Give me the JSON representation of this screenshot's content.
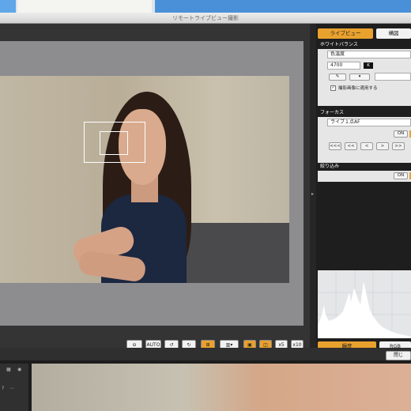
{
  "window": {
    "title": "リモートライブビュー撮影"
  },
  "right_panel": {
    "tabs": [
      "ライブビュー",
      "構図"
    ],
    "white_balance": {
      "header": "ホワイトバランス",
      "mode": "色温度",
      "kelvin_value": "4700",
      "kelvin_unit": "K",
      "apply_checkbox_label": "撮影画像に適用する",
      "apply_checked": true
    },
    "focus": {
      "header": "フォーカス",
      "af_mode": "ライブ１点AF",
      "on_label": "ON",
      "nav_buttons": [
        "<<<",
        "<<",
        "<",
        ">",
        ">>"
      ]
    },
    "aperture": {
      "header": "絞り込み",
      "on_label": "ON"
    },
    "histogram_tabs": [
      "輝度",
      "RGB"
    ]
  },
  "toolbar": {
    "auto_label": "AUTO",
    "zoom_labels": [
      "x5",
      "x10"
    ]
  },
  "close_button": "閉じ",
  "colors": {
    "accent": "#e9a12e",
    "panel_bg": "#1e1e1e",
    "stage_bg": "#8d8d90"
  },
  "icons": [
    "crosshair-icon",
    "auto-rotate-icon",
    "rotate-left-icon",
    "rotate-right-icon",
    "af-frame-icon",
    "grid-icon",
    "fit-icon",
    "x5-icon",
    "x10-icon",
    "eyedropper-icon",
    "dropdown-icon"
  ]
}
